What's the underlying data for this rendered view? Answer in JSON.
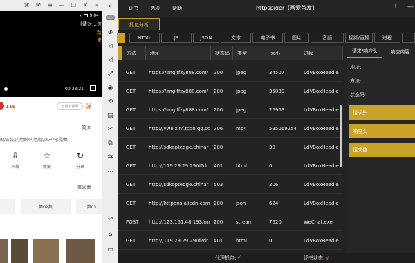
{
  "phone": {
    "video_text": "[请对…信",
    "video_side_1": "新",
    "video_side_2": "来",
    "time": "00:33:21",
    "status_time": "9:04",
    "score": "116",
    "danmu_placeholder": "点我发弹幕",
    "intro": "简介",
    "tags": "剧/古装/内地剧/内地/情/国产/电视/集",
    "actions": [
      {
        "icon": "download-icon",
        "glyph": "⇩",
        "label": "下载"
      },
      {
        "icon": "star-icon",
        "glyph": "☆",
        "label": "收藏"
      },
      {
        "icon": "share-icon",
        "glyph": "↻",
        "label": "分享"
      }
    ],
    "episode_header": "第19集 ›",
    "episodes": [
      "第02集",
      "第03"
    ]
  },
  "app": {
    "menu": [
      "证书",
      "选项",
      "帮助"
    ],
    "title": "httpspider【吾爱首发】",
    "sub_tab": "抓包分析",
    "type_tabs": [
      "",
      "HTML",
      "JS",
      "JSON",
      "文本",
      "电子书",
      "图片",
      "音频",
      "视频/直播",
      "进程",
      ""
    ],
    "columns": [
      "方法",
      "地址",
      "状态码",
      "类型",
      "大小",
      "进程"
    ],
    "rows": [
      {
        "method": "GET",
        "url": "https://img.ffzy888.com/",
        "status": "200",
        "type": "jpeg",
        "size": "34507",
        "process": "LdVBoxHeadle"
      },
      {
        "method": "GET",
        "url": "https://img.ffzy888.com/",
        "status": "200",
        "type": "jpeg",
        "size": "35039",
        "process": "LdVBoxHeadle"
      },
      {
        "method": "GET",
        "url": "https://img.ffzy888.com/",
        "status": "200",
        "type": "jpeg",
        "size": "26963",
        "process": "LdVBoxHeadle"
      },
      {
        "method": "GET",
        "url": "http://vweixinf.tcdn.qq.cc",
        "status": "206",
        "type": "mp4",
        "size": "535069254",
        "process": "LdVBoxHeadle"
      },
      {
        "method": "GET",
        "url": "http://sdkoptedge.chinar",
        "status": "200",
        "type": "",
        "size": "30",
        "process": "LdVBoxHeadle"
      },
      {
        "method": "GET",
        "url": "http://119.29.29.29/d?dr",
        "status": "401",
        "type": "html",
        "size": "0",
        "process": "LdVBoxHeadle"
      },
      {
        "method": "GET",
        "url": "http://sdkoptedge.chinar",
        "status": "503",
        "type": "",
        "size": "206",
        "process": "LdVBoxHeadle"
      },
      {
        "method": "GET",
        "url": "http://httpdns.alicdn.com",
        "status": "200",
        "type": "json",
        "size": "624",
        "process": "LdVBoxHeadle"
      },
      {
        "method": "POST",
        "url": "http://123.151.48.193/mr",
        "status": "200",
        "type": "stream",
        "size": "7620",
        "process": "WeChat.exe"
      },
      {
        "method": "GET",
        "url": "http://119.29.29.29/d?dr",
        "status": "401",
        "type": "html",
        "size": "0",
        "process": "LdVBoxHeadle"
      }
    ],
    "panel": {
      "tabs": [
        "请求/响应头",
        "响应内容"
      ],
      "labels": [
        "地址:",
        "方法:",
        "状态码:"
      ],
      "buttons": [
        "请求头",
        "响应头",
        "请求体"
      ]
    },
    "status": {
      "proxy_label": "代理抓包:",
      "proxy_value": "√",
      "cert_label": "证书状态:",
      "cert_value": "√"
    }
  },
  "colors": {
    "accent": "#c9a227",
    "background": "#232323"
  }
}
